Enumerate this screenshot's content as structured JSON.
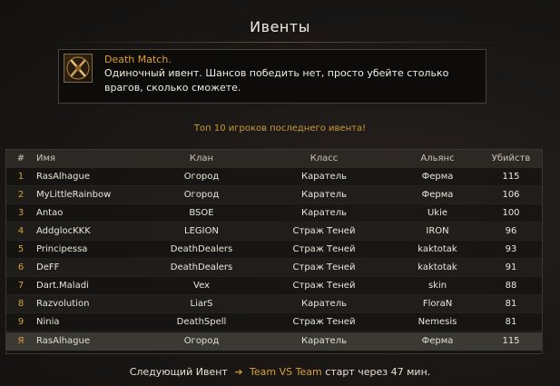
{
  "window": {
    "title": "Ивенты"
  },
  "event": {
    "icon": "crossed-swords-icon",
    "name": "Death Match.",
    "description": " Одиночный ивент. Шансов победить нет, просто убейте столько врагов, сколько сможете."
  },
  "leaderboard": {
    "caption": "Топ 10 игроков последнего ивента!",
    "headers": {
      "rank": "#",
      "name": "Имя",
      "clan": "Клан",
      "class": "Класс",
      "alliance": "Альянс",
      "kills": "Убийств"
    },
    "rows": [
      {
        "rank": "1",
        "name": "RasAlhague",
        "clan": "Огород",
        "class": "Каратель",
        "alliance": "Ферма",
        "kills": "115"
      },
      {
        "rank": "2",
        "name": "MyLittleRainbow",
        "clan": "Огород",
        "class": "Каратель",
        "alliance": "Ферма",
        "kills": "106"
      },
      {
        "rank": "3",
        "name": "Antao",
        "clan": "BSOE",
        "class": "Каратель",
        "alliance": "Ukie",
        "kills": "100"
      },
      {
        "rank": "4",
        "name": "AddglocKKK",
        "clan": "LEGION",
        "class": "Страж Теней",
        "alliance": "IRON",
        "kills": "96"
      },
      {
        "rank": "5",
        "name": "Principessa",
        "clan": "DeathDealers",
        "class": "Страж Теней",
        "alliance": "kaktotak",
        "kills": "93"
      },
      {
        "rank": "6",
        "name": "DeFF",
        "clan": "DeathDealers",
        "class": "Страж Теней",
        "alliance": "kaktotak",
        "kills": "91"
      },
      {
        "rank": "7",
        "name": "Dart.Maladi",
        "clan": "Vex",
        "class": "Страж Теней",
        "alliance": "skin",
        "kills": "88"
      },
      {
        "rank": "8",
        "name": "Razvolution",
        "clan": "LiarS",
        "class": "Каратель",
        "alliance": "FloraN",
        "kills": "81"
      },
      {
        "rank": "9",
        "name": "Ninia",
        "clan": "DeathSpell",
        "class": "Страж Теней",
        "alliance": "Nemesis",
        "kills": "81"
      }
    ],
    "self_row": {
      "rank": "Я",
      "name": "RasAlhague",
      "clan": "Огород",
      "class": "Каратель",
      "alliance": "Ферма",
      "kills": "115"
    }
  },
  "next_event": {
    "label": "Следующий Ивент",
    "arrow": "➔",
    "name": "Team VS Team",
    "time": "старт через 47 мин."
  },
  "colors": {
    "accent_gold": "#d9a03a",
    "event_name": "#e0a020",
    "background": "#1b1816"
  }
}
